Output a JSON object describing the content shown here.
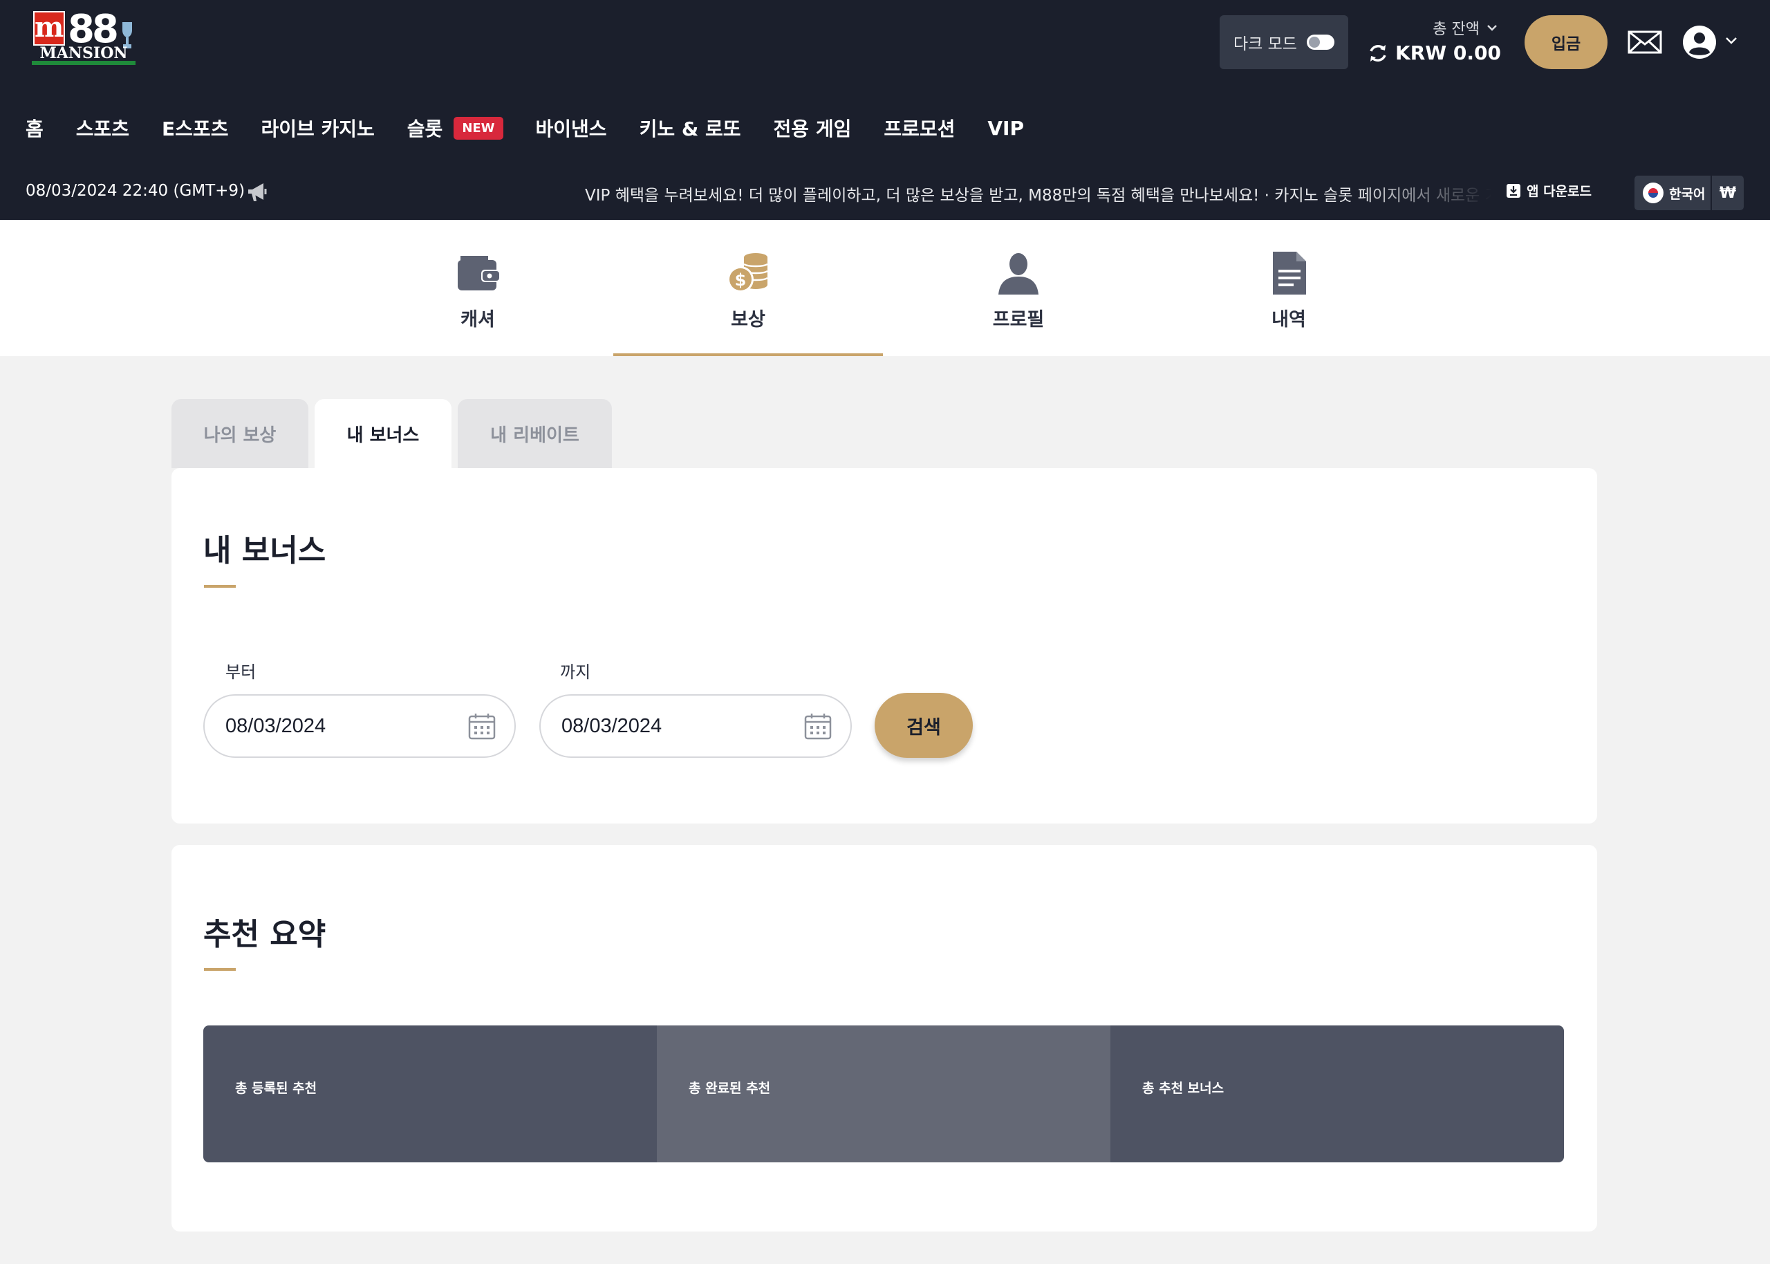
{
  "header": {
    "logo": {
      "badge_letter": "m",
      "number": "88",
      "wordmark": "MANSION"
    },
    "dark_mode_label": "다크 모드",
    "balance_label": "총 잔액",
    "balance_amount": "KRW 0.00",
    "deposit_label": "입금"
  },
  "nav": {
    "items": [
      "홈",
      "스포츠",
      "E스포츠",
      "라이브 카지노",
      "슬롯",
      "바이낸스",
      "키노 & 로또",
      "전용 게임",
      "프로모션",
      "VIP"
    ],
    "new_badge": "NEW"
  },
  "infobar": {
    "datetime": "08/03/2024 22:40 (GMT+9)",
    "ticker": "VIP 혜택을 누려보세요! 더 많이 플레이하고, 더 많은 보상을 받고, M88만의 독점 혜택을 만나보세요!  ·  카지노 슬롯 페이지에서 새로운 기능을",
    "app_download": "앱 다운로드",
    "language": "한국어",
    "currency_symbol": "₩"
  },
  "main_tabs": [
    {
      "label": "캐셔",
      "icon": "wallet-icon"
    },
    {
      "label": "보상",
      "icon": "coins-icon",
      "active": true
    },
    {
      "label": "프로필",
      "icon": "person-icon"
    },
    {
      "label": "내역",
      "icon": "document-icon"
    }
  ],
  "sub_tabs": [
    {
      "label": "나의 보상"
    },
    {
      "label": "내 보너스",
      "active": true
    },
    {
      "label": "내 리베이트"
    }
  ],
  "bonus_card": {
    "title": "내 보너스",
    "from_label": "부터",
    "to_label": "까지",
    "from_value": "08/03/2024",
    "to_value": "08/03/2024",
    "search_label": "검색"
  },
  "referral_card": {
    "title": "추천 요약",
    "cells": [
      "총 등록된 추천",
      "총 완료된 추천",
      "총 추천 보너스"
    ]
  },
  "colors": {
    "header_bg": "#1b1f2c",
    "accent_gold": "#c9a46a",
    "badge_red": "#d8283c",
    "summary_dark": "#4e5363",
    "summary_mid": "#646875"
  }
}
